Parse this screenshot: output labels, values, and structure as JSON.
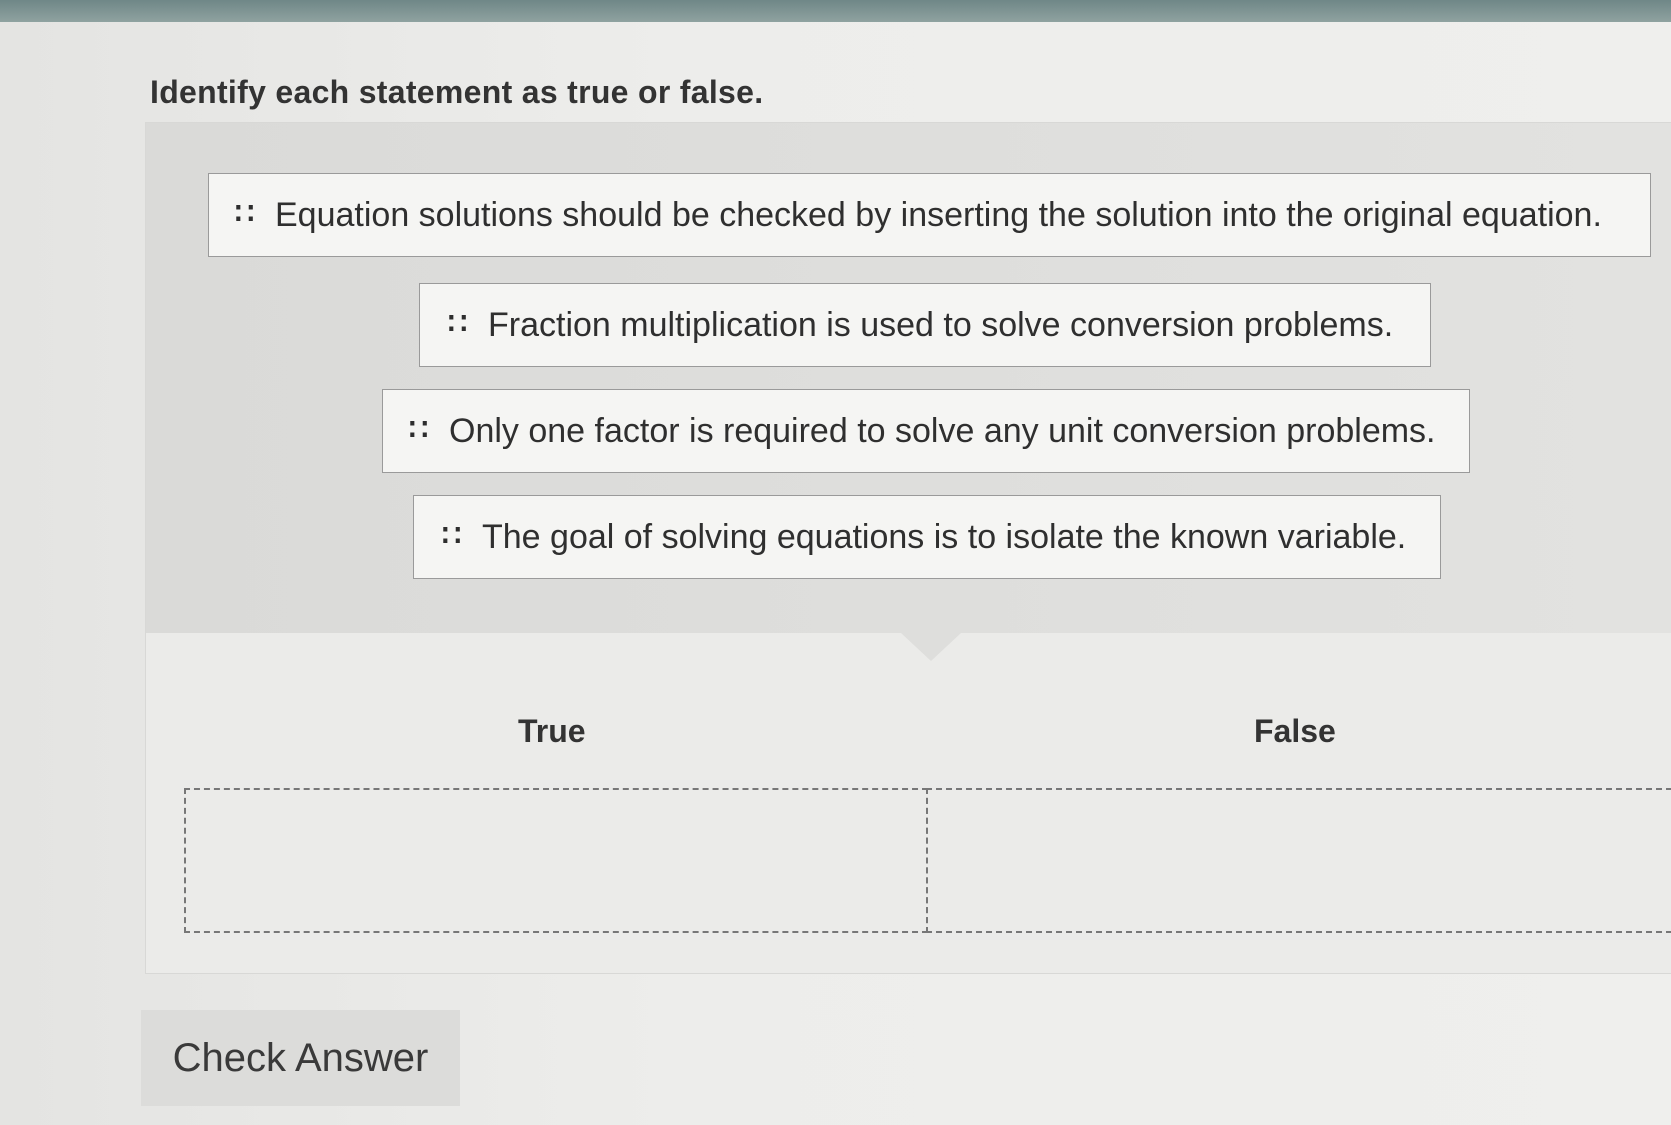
{
  "instruction": "Identify each statement as true or false.",
  "statements": [
    "Equation solutions should be checked by inserting the solution into the original equation.",
    "Fraction multiplication is used to solve conversion problems.",
    "Only one factor is required to solve any unit conversion problems.",
    "The goal of solving equations is to isolate the known variable."
  ],
  "categories": {
    "true_label": "True",
    "false_label": "False"
  },
  "buttons": {
    "check_answer": "Check Answer"
  },
  "icons": {
    "card_grip": "drag-handle-icon"
  },
  "colors": {
    "top_bar": "#7e9594",
    "source_area": "#dededc",
    "card_border": "#9a9a9a",
    "button_bg": "#dcdcda"
  }
}
